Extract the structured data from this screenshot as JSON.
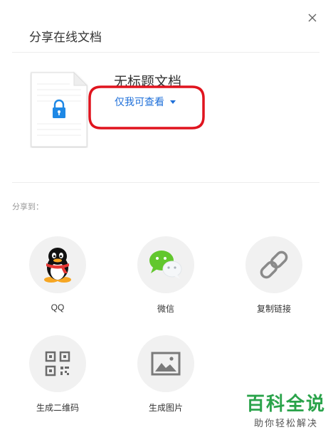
{
  "dialog": {
    "title": "分享在线文档",
    "close_icon": "close-icon"
  },
  "document": {
    "name": "无标题文档",
    "permission": "仅我可查看",
    "icon": "document-lock-icon",
    "lock_color": "#1e88e5"
  },
  "share": {
    "heading": "分享到：",
    "options": [
      {
        "label": "QQ",
        "icon": "qq-penguin-icon"
      },
      {
        "label": "微信",
        "icon": "wechat-icon"
      },
      {
        "label": "复制链接",
        "icon": "link-icon"
      },
      {
        "label": "生成二维码",
        "icon": "qr-code-icon"
      },
      {
        "label": "生成图片",
        "icon": "image-icon"
      }
    ]
  },
  "annotation": {
    "color": "#e0141e"
  },
  "watermark": {
    "brand": "百科全说",
    "slogan": "助你轻松解决",
    "color": "#2aa34a"
  }
}
